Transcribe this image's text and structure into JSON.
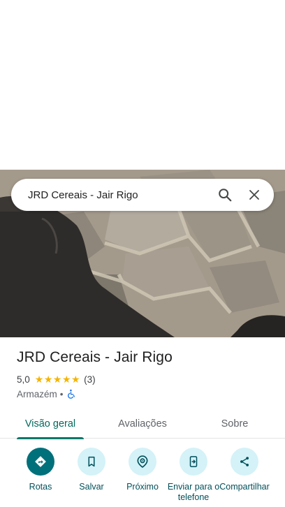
{
  "search": {
    "query": "JRD Cereais - Jair Rigo"
  },
  "place": {
    "name": "JRD Cereais - Jair Rigo",
    "rating": "5,0",
    "stars": 5,
    "review_count": "(3)",
    "category": "Armazém",
    "separator": "•"
  },
  "tabs": [
    {
      "label": "Visão geral",
      "active": true
    },
    {
      "label": "Avaliações",
      "active": false
    },
    {
      "label": "Sobre",
      "active": false
    }
  ],
  "actions": [
    {
      "label": "Rotas",
      "icon": "directions-icon"
    },
    {
      "label": "Salvar",
      "icon": "bookmark-icon"
    },
    {
      "label": "Próximo",
      "icon": "nearby-icon"
    },
    {
      "label": "Enviar para o telefone",
      "icon": "send-to-phone-icon"
    },
    {
      "label": "Compartilhar",
      "icon": "share-icon"
    }
  ],
  "colors": {
    "accent": "#00796b",
    "primary_action": "#00707a",
    "action_circle": "#d4f2f8",
    "star": "#f4b400"
  }
}
